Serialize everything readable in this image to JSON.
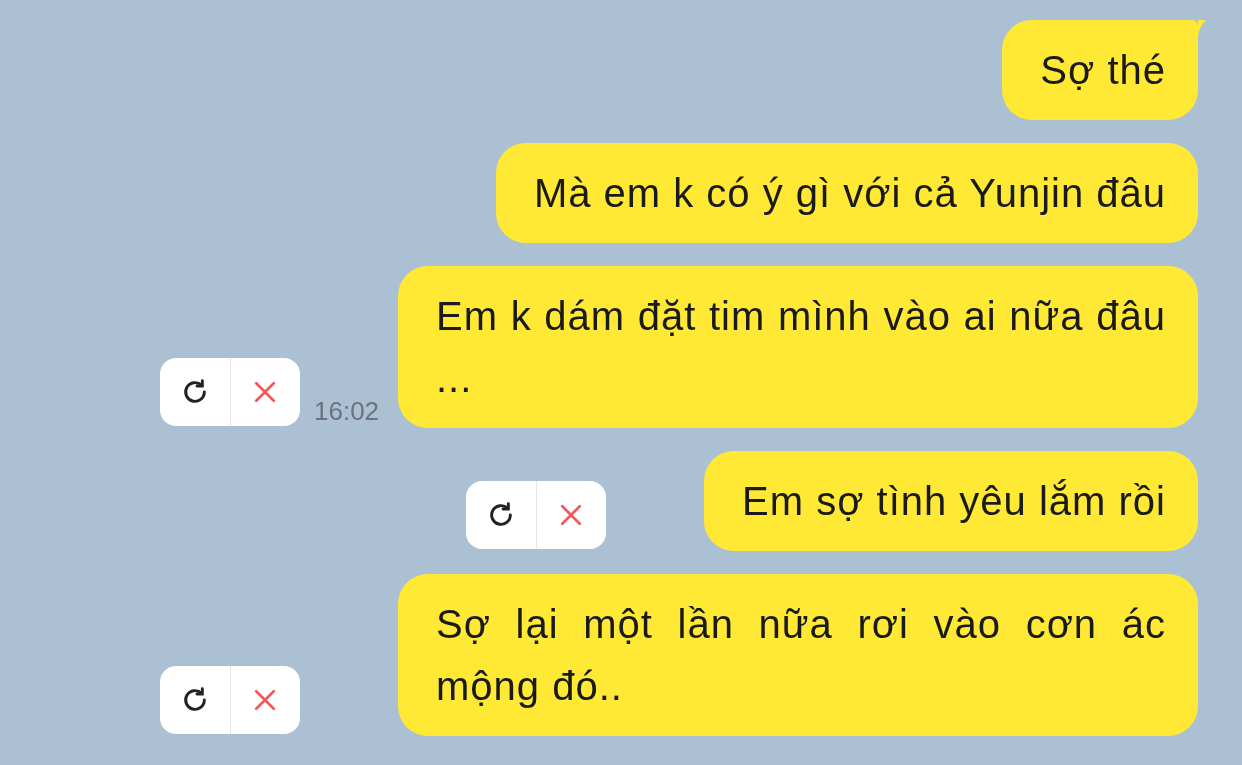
{
  "messages": [
    {
      "text": "Sợ thé",
      "tail": true,
      "failed": false
    },
    {
      "text": "Mà em k có ý gì với cả Yunjin đâu",
      "tail": false,
      "failed": false
    },
    {
      "text": "Em k dám đặt tim mình vào ai nữa đâu ...",
      "tail": false,
      "failed": true,
      "time": "16:02"
    },
    {
      "text": "Em sợ tình yêu lắm rồi",
      "tail": false,
      "failed": true
    },
    {
      "text": "Sợ lại một lần nữa rơi vào cơn ác mộng đó..",
      "tail": false,
      "failed": true
    }
  ]
}
